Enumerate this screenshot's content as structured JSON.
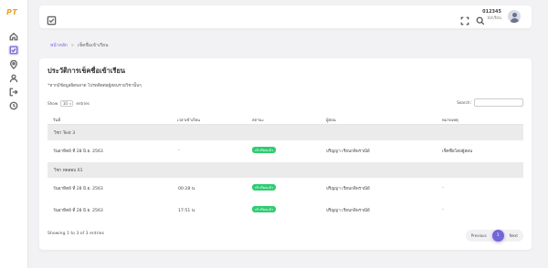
{
  "app": {
    "logo": "PT"
  },
  "topbar": {
    "user_id": "012345",
    "user_role": "นักเรียน"
  },
  "breadcrumb": {
    "home": "หน้าหลัก",
    "separator": "»",
    "current": "เช็คชื่อเข้าเรียน"
  },
  "card": {
    "title": "ประวัติการเช็คชื่อเข้าเรียน",
    "note": "*หากมีข้อมูลผิดพลาด โปรดติดต่อผู้สอนรายวิชานั้นๆ"
  },
  "table_controls": {
    "show_label": "Show",
    "show_value": "10",
    "entries_label": "entries",
    "search_label": "Search:"
  },
  "table": {
    "headers": [
      "วันที่",
      "เวลาเข้าเรียน",
      "สถานะ",
      "ผู้สอน",
      "หมายเหตุ"
    ],
    "groups": [
      {
        "name": "วิชา Test 3",
        "rows": [
          {
            "date": "วันอาทิตย์ ที่ 28 มิ.ย. 2563",
            "time": "-",
            "status": "เข้าเรียนแล้ว",
            "teacher": "ปริญญา เรียนกลิพราณีย์",
            "remark": "เช็คชื่อโดยผู้สอน"
          }
        ]
      },
      {
        "name": "วิชา ทดสอบ 01",
        "rows": [
          {
            "date": "วันอาทิตย์ ที่ 28 มิ.ย. 2563",
            "time": "00:28 น.",
            "status": "เข้าเรียนแล้ว",
            "teacher": "ปริญญา เรียนกลิพราณีย์",
            "remark": "-"
          },
          {
            "date": "วันอาทิตย์ ที่ 28 มิ.ย. 2563",
            "time": "17:51 น.",
            "status": "เข้าเรียนแล้ว",
            "teacher": "ปริญญา เรียนกลิพราณีย์",
            "remark": "-"
          }
        ]
      }
    ]
  },
  "footer": {
    "info": "Showing 1 to 3 of 3 entries",
    "previous": "Previous",
    "page": "1",
    "next": "Next"
  },
  "colors": {
    "accent": "#7366d8",
    "logo": "#f0a020",
    "status_ok": "#2ecc71"
  }
}
